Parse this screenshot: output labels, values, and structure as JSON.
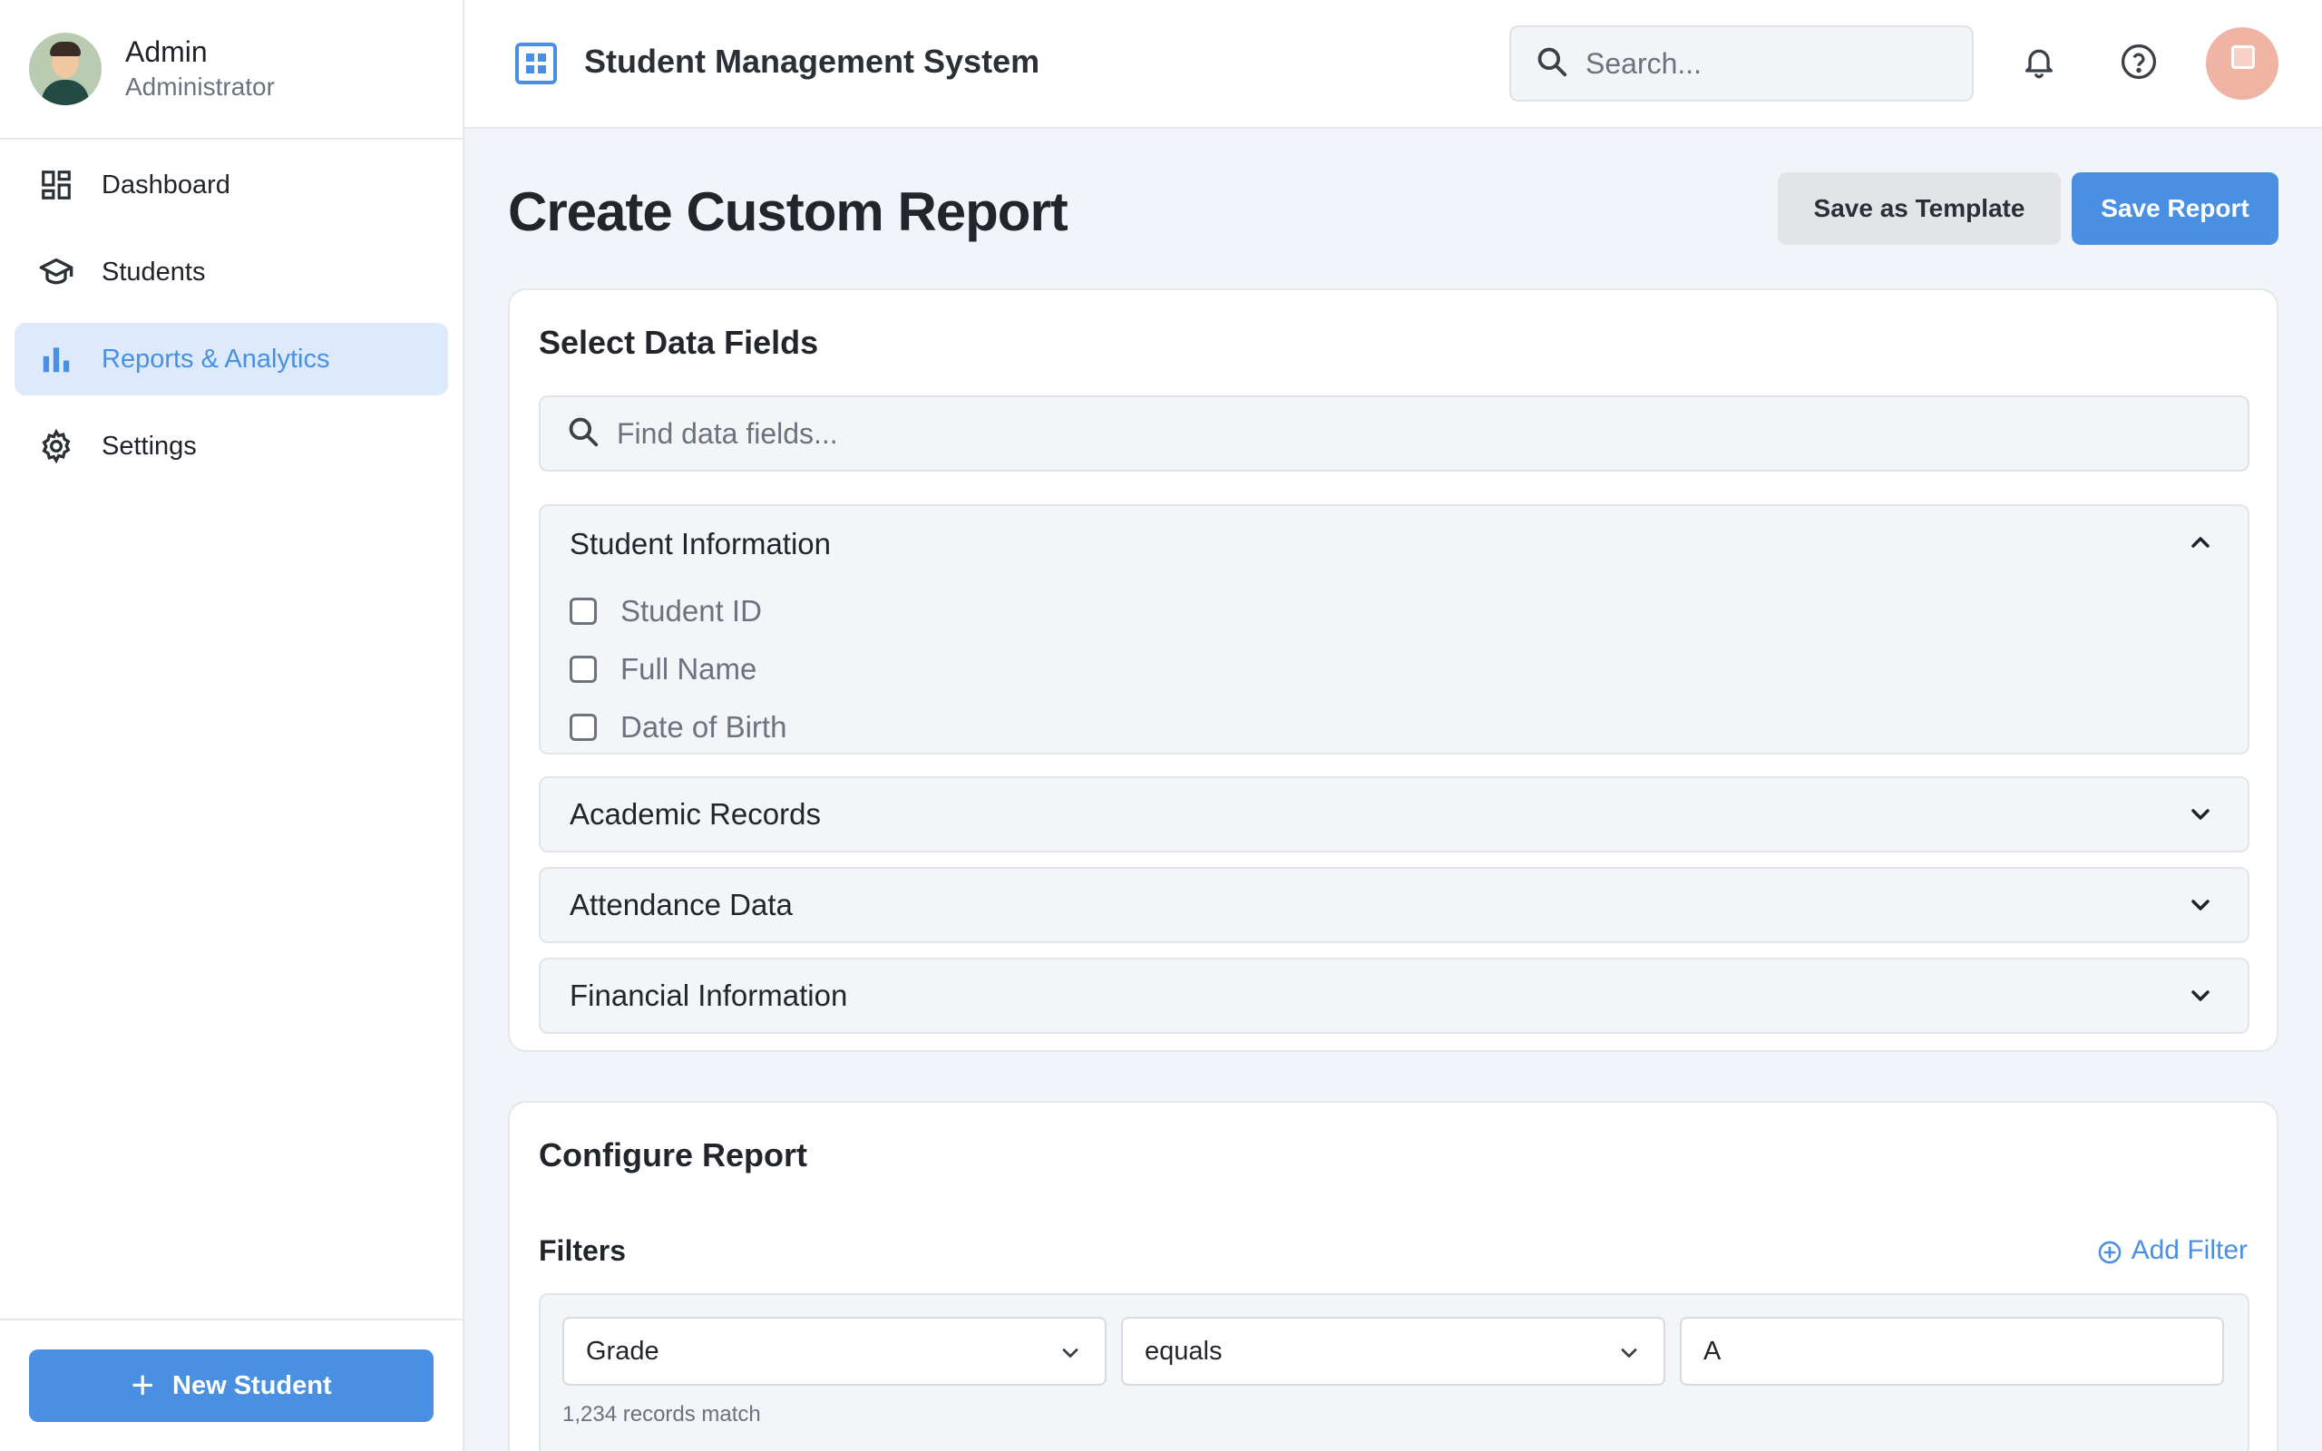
{
  "sidebar": {
    "profile": {
      "name": "Admin",
      "role": "Administrator"
    },
    "items": [
      {
        "label": "Dashboard",
        "icon": "dashboard-icon",
        "active": false
      },
      {
        "label": "Students",
        "icon": "graduation-cap-icon",
        "active": false
      },
      {
        "label": "Reports & Analytics",
        "icon": "bar-chart-icon",
        "active": true
      },
      {
        "label": "Settings",
        "icon": "gear-icon",
        "active": false
      }
    ],
    "new_student_label": "New Student"
  },
  "header": {
    "title": "Student Management System",
    "search_placeholder": "Search..."
  },
  "page": {
    "title": "Create Custom Report",
    "save_template_label": "Save as Template",
    "save_report_label": "Save Report"
  },
  "data_fields": {
    "title": "Select Data Fields",
    "search_placeholder": "Find data fields...",
    "groups": [
      {
        "title": "Student Information",
        "expanded": true,
        "fields": [
          "Student ID",
          "Full Name",
          "Date of Birth"
        ]
      },
      {
        "title": "Academic Records",
        "expanded": false
      },
      {
        "title": "Attendance Data",
        "expanded": false
      },
      {
        "title": "Financial Information",
        "expanded": false
      }
    ]
  },
  "configure": {
    "title": "Configure Report",
    "filters_label": "Filters",
    "add_filter_label": "Add Filter",
    "filter": {
      "field": "Grade",
      "operator": "equals",
      "value": "A"
    },
    "match_text": "1,234 records match"
  },
  "colors": {
    "accent": "#4a90e2",
    "active_bg": "#dceafb"
  }
}
